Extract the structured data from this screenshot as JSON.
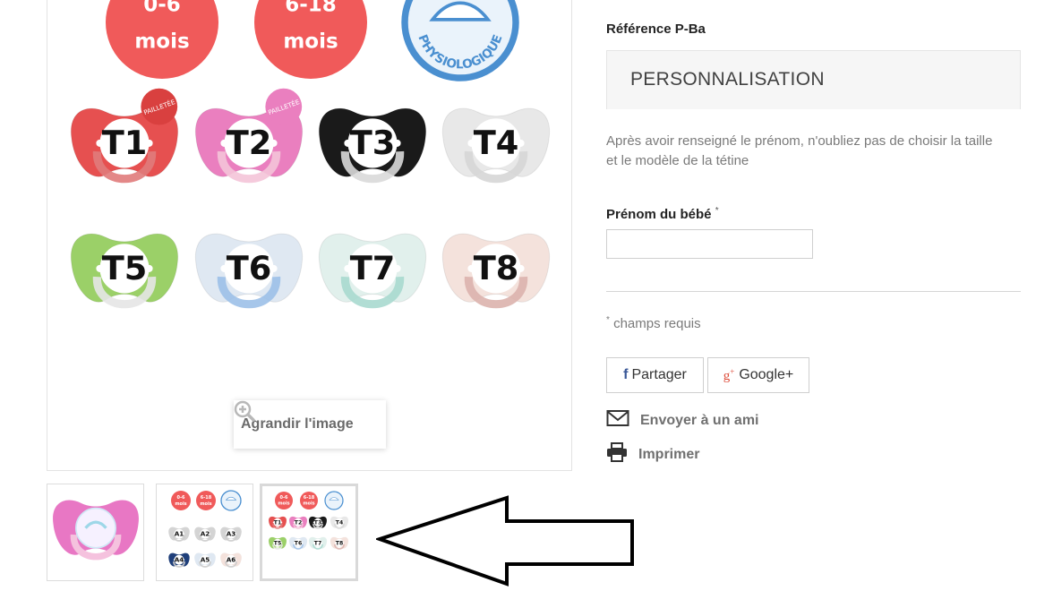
{
  "product": {
    "reference_label": "Référence",
    "reference_value": "P-Ba"
  },
  "main_image": {
    "age_badges": [
      {
        "line1": "0-6",
        "line2": "mois"
      },
      {
        "line1": "6-18",
        "line2": "mois"
      }
    ],
    "physio_badge": "PHYSIOLOGIQUE",
    "pacifiers": [
      {
        "label": "T1",
        "ring": "#e07b7b",
        "shield": "#e65050",
        "tag": "PAILLETÉE"
      },
      {
        "label": "T2",
        "ring": "#f4c4d8",
        "shield": "#ea7fbf",
        "tag": "PAILLETÉE"
      },
      {
        "label": "T3",
        "ring": "#d9d9d9",
        "shield": "#1a1a1a",
        "tag": ""
      },
      {
        "label": "T4",
        "ring": "#d6d6d6",
        "shield": "#e8e8e8",
        "tag": ""
      },
      {
        "label": "T5",
        "ring": "#e6e6e6",
        "shield": "#9bd068",
        "tag": ""
      },
      {
        "label": "T6",
        "ring": "#9cc0e8",
        "shield": "#dfe8f2",
        "tag": ""
      },
      {
        "label": "T7",
        "ring": "#a9d9cf",
        "shield": "#e1f0ec",
        "tag": ""
      },
      {
        "label": "T8",
        "ring": "#dcb2ad",
        "shield": "#f4e2dc",
        "tag": ""
      }
    ],
    "enlarge_label": "Agrandir l'image"
  },
  "thumbnails": [
    {
      "name": "thumb-pink-unicorn"
    },
    {
      "name": "thumb-a-models",
      "labels": [
        "0-6 mois",
        "6-18 mois",
        "A1",
        "A2",
        "A3",
        "A4",
        "A5",
        "A6"
      ]
    },
    {
      "name": "thumb-t-models",
      "labels": [
        "0-6 mois",
        "6-18 mois",
        "T1",
        "T2",
        "T3",
        "T4",
        "T5",
        "T6",
        "T7",
        "T8"
      ]
    }
  ],
  "personalization": {
    "title": "PERSONNALISATION",
    "instructions": "Après avoir renseigné le prénom, n'oubliez pas de choisir la taille et le modèle de la tétine",
    "field_label": "Prénom du bébé",
    "field_required_mark": "*",
    "field_value": "",
    "required_note": "champs requis",
    "required_mark": "*"
  },
  "social": {
    "facebook_label": "Partager",
    "facebook_icon": "facebook-icon",
    "google_label": "Google+",
    "google_icon": "google-plus-icon"
  },
  "actions": {
    "send_friend": "Envoyer à un ami",
    "send_icon": "envelope-icon",
    "print": "Imprimer",
    "print_icon": "printer-icon"
  },
  "annotation": {
    "arrow": "left-pointing-arrow"
  },
  "colors": {
    "age_badge": "#f05a5a",
    "physio_badge": "#4a8fd0",
    "facebook": "#3b5998",
    "google": "#dd4b39"
  }
}
